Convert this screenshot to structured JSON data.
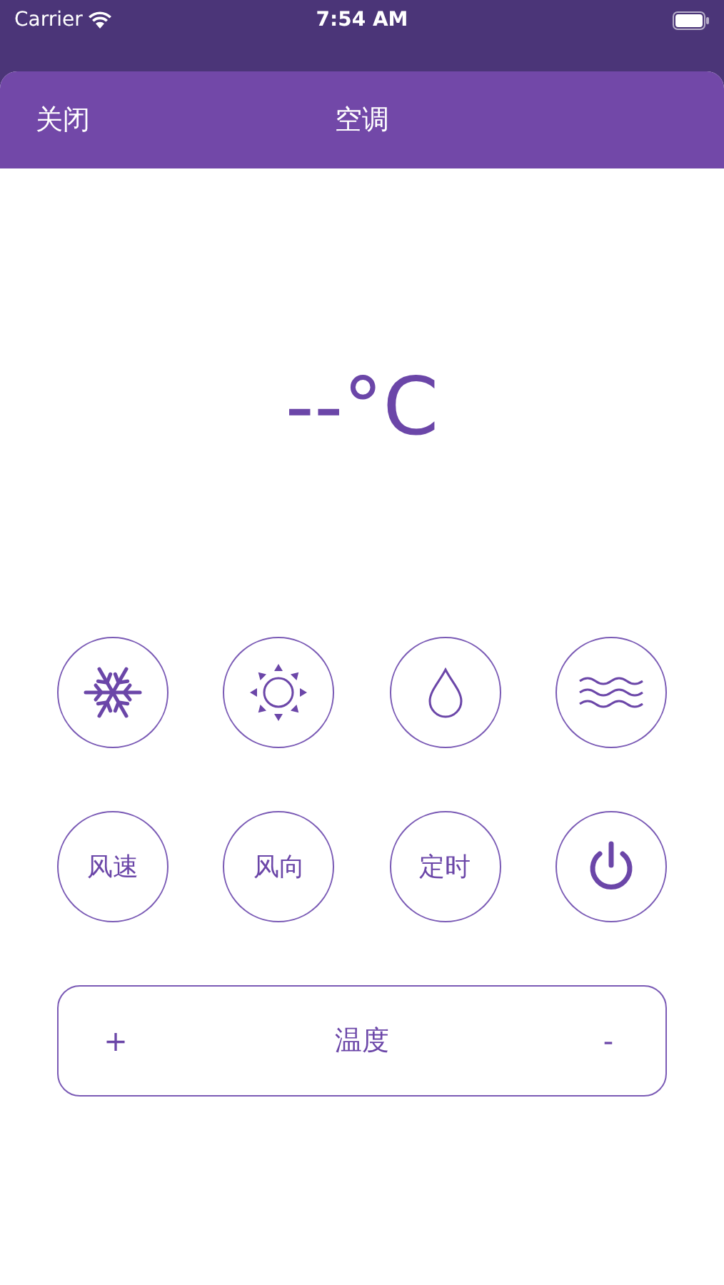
{
  "status_bar": {
    "carrier": "Carrier",
    "time": "7:54 AM"
  },
  "header": {
    "close": "关闭",
    "title": "空调"
  },
  "temperature": "--°C",
  "modes": [
    {
      "kind": "snowflake"
    },
    {
      "kind": "sun"
    },
    {
      "kind": "drop"
    },
    {
      "kind": "waves"
    }
  ],
  "controls": [
    {
      "kind": "text",
      "label": "风速"
    },
    {
      "kind": "text",
      "label": "风向"
    },
    {
      "kind": "text",
      "label": "定时"
    },
    {
      "kind": "power"
    }
  ],
  "temp_bar": {
    "plus": "+",
    "label": "温度",
    "minus": "-"
  }
}
